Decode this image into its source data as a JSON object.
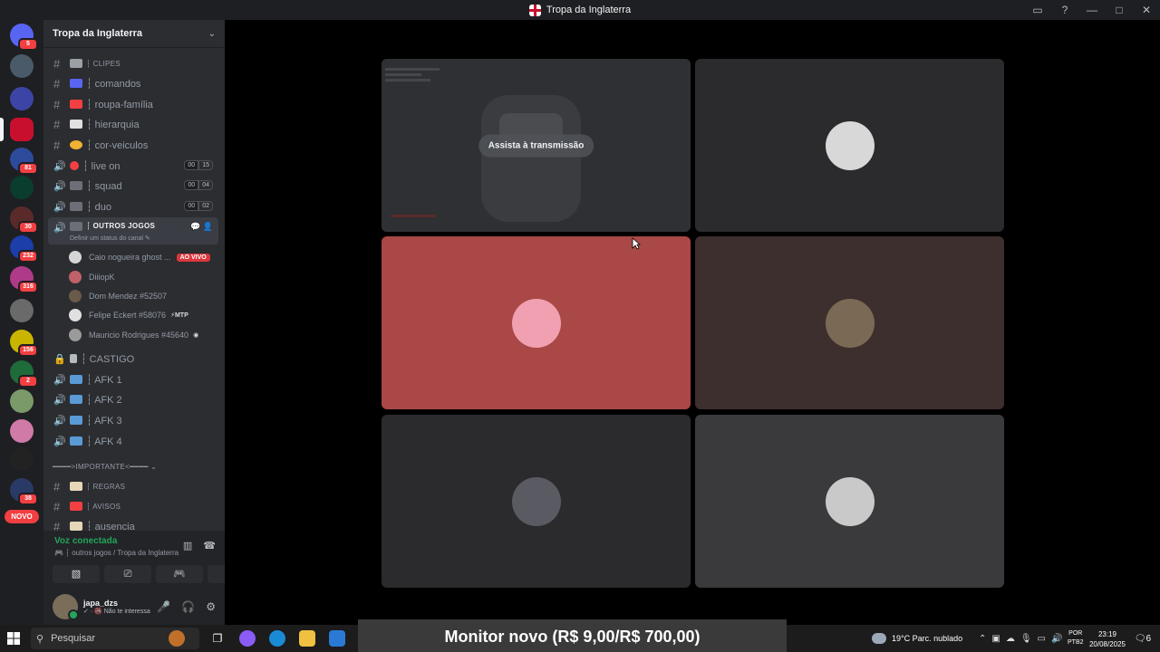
{
  "window": {
    "title": "Tropa da Inglaterra",
    "controls": [
      "▭",
      "?",
      "—",
      "□",
      "✕"
    ]
  },
  "rail": {
    "badges": [
      "5",
      "81",
      "30",
      "232",
      "316",
      "156",
      "2",
      "38"
    ],
    "novo_label": "NOVO"
  },
  "guild": {
    "name": "Tropa da Inglaterra",
    "chevron": "⌄"
  },
  "channels": [
    {
      "kind": "text",
      "name": "┆ clipes",
      "small": true,
      "emoji_color": "#9aa0a6"
    },
    {
      "kind": "text",
      "name": "┆ comandos",
      "small": false,
      "emoji_color": "#5865f2"
    },
    {
      "kind": "text",
      "name": "┆ roupa-família",
      "small": false,
      "emoji_color": "#f23f42"
    },
    {
      "kind": "text",
      "name": "┆ hierarquia",
      "small": false,
      "emoji_color": "#e0e0e0"
    },
    {
      "kind": "text",
      "name": "┆ cor-veiculos",
      "small": false,
      "emoji_color": "#f0b232"
    },
    {
      "kind": "voice",
      "name": "┆ live on",
      "small": false,
      "emoji_color": "#f23f42",
      "count": "00",
      "limit": "15"
    },
    {
      "kind": "voice",
      "name": "┆ squad",
      "small": false,
      "emoji_color": "#6d6f78",
      "count": "00",
      "limit": "04"
    },
    {
      "kind": "voice",
      "name": "┆ duo",
      "small": false,
      "emoji_color": "#6d6f78",
      "count": "00",
      "limit": "02"
    }
  ],
  "active_channel": {
    "name": "┆ outros jogos",
    "status_hint": "Definir um status do canal ✎",
    "actions": "💬 👤"
  },
  "members": [
    {
      "name": "Caio nogueira ghost ...",
      "badge": "AO VIVO"
    },
    {
      "name": "DiiiopK",
      "badge": ""
    },
    {
      "name": "Dom Mendez #52507",
      "badge": ""
    },
    {
      "name": "Felipe Eckert #58076",
      "badge": "⚡MTP"
    },
    {
      "name": "Mauricio Rodrigues #45640",
      "badge": "◉"
    }
  ],
  "channels_lower": [
    {
      "kind": "lock",
      "name": "┆ CASTIGO",
      "small": false
    },
    {
      "kind": "voice",
      "name": "┆ AFK 1",
      "small": false
    },
    {
      "kind": "voice",
      "name": "┆ AFK 2",
      "small": false
    },
    {
      "kind": "voice",
      "name": "┆ AFK 3",
      "small": false
    },
    {
      "kind": "voice",
      "name": "┆ AFK 4",
      "small": false
    }
  ],
  "category": "━━━━>IMPORTANTE<━━━━ ⌄",
  "channels_important": [
    {
      "kind": "text",
      "name": "┆ regras",
      "small": true
    },
    {
      "kind": "text",
      "name": "┆ avisos",
      "small": true
    },
    {
      "kind": "text",
      "name": "┆ ausencia",
      "small": false
    }
  ],
  "voice_panel": {
    "status": "Voz conectada",
    "location": "🎮 ┆ outros jogos / Tropa da Inglaterra"
  },
  "user": {
    "name": "japa_dzs",
    "status": "✓ · 🚳 Não te interessa"
  },
  "stage": {
    "stream_button": "Assista à transmissão",
    "tile_colors": [
      "#2e3033",
      "#2b2b2d",
      "#a94846",
      "#3d2f2d",
      "#2b2b2d",
      "#3a3a3c"
    ]
  },
  "taskbar": {
    "search_placeholder": "Pesquisar",
    "caption": "Monitor novo (R$ 9,00/R$ 700,00)",
    "weather": "19°C  Parc. nublado",
    "lang_top": "POR",
    "lang_bottom": "PTB2",
    "time": "23:19",
    "date": "20/08/2025",
    "notification_count": "6"
  }
}
